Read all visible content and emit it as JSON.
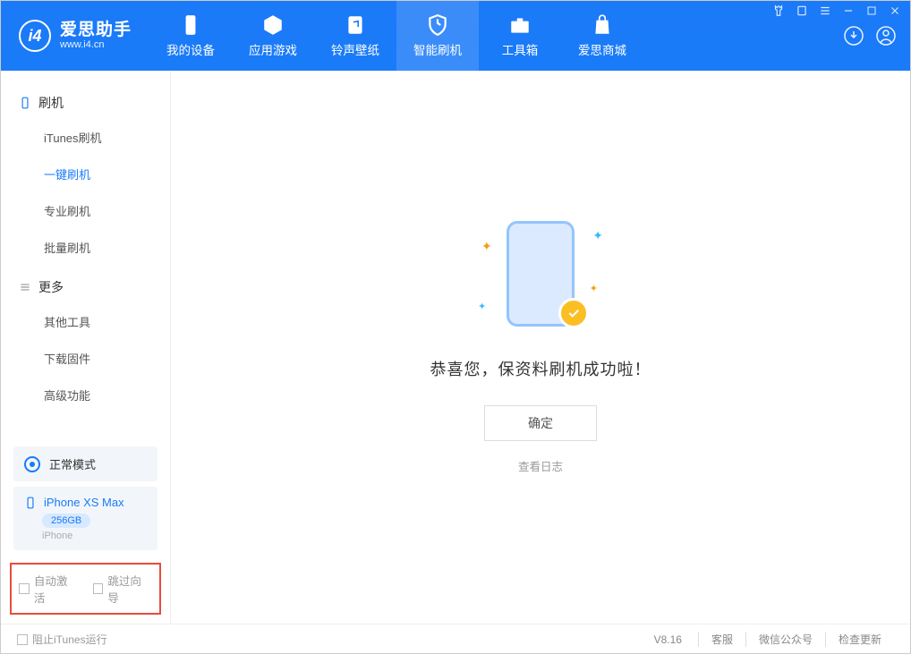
{
  "app": {
    "title": "爱思助手",
    "subtitle": "www.i4.cn"
  },
  "nav": {
    "items": [
      {
        "label": "我的设备"
      },
      {
        "label": "应用游戏"
      },
      {
        "label": "铃声壁纸"
      },
      {
        "label": "智能刷机"
      },
      {
        "label": "工具箱"
      },
      {
        "label": "爱思商城"
      }
    ]
  },
  "sidebar": {
    "group1": {
      "title": "刷机",
      "items": [
        {
          "label": "iTunes刷机"
        },
        {
          "label": "一键刷机"
        },
        {
          "label": "专业刷机"
        },
        {
          "label": "批量刷机"
        }
      ]
    },
    "group2": {
      "title": "更多",
      "items": [
        {
          "label": "其他工具"
        },
        {
          "label": "下载固件"
        },
        {
          "label": "高级功能"
        }
      ]
    },
    "mode": "正常模式",
    "device": {
      "name": "iPhone XS Max",
      "storage": "256GB",
      "type": "iPhone"
    },
    "opts": {
      "auto_activate": "自动激活",
      "skip_guide": "跳过向导"
    }
  },
  "main": {
    "success_msg": "恭喜您，保资料刷机成功啦！",
    "ok_btn": "确定",
    "log_link": "查看日志"
  },
  "footer": {
    "block_itunes": "阻止iTunes运行",
    "version": "V8.16",
    "links": {
      "support": "客服",
      "wechat": "微信公众号",
      "update": "检查更新"
    }
  }
}
